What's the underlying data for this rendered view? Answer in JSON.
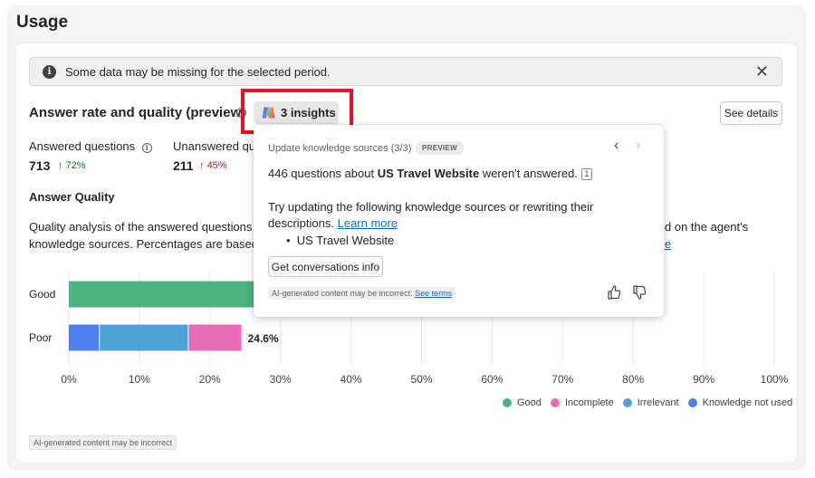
{
  "page": {
    "title": "Usage",
    "warning": {
      "text": "Some data may be missing for the selected period.",
      "close_glyph": "✕"
    },
    "section": {
      "title": "Answer rate and quality (preview)",
      "insights_label": "3 insights",
      "see_details_label": "See details"
    },
    "metrics": {
      "answered": {
        "label": "Answered questions",
        "value": "713",
        "trend": "72%",
        "direction": "up"
      },
      "unanswered": {
        "label": "Unanswered qu",
        "value": "211",
        "trend": "45%",
        "direction": "up"
      }
    },
    "answer_quality": {
      "title": "Answer Quality",
      "desc_line1_a": "Quality analysis of the answered questions",
      "desc_line1_b": "d on the agent's",
      "desc_line2_a": "knowledge sources. Percentages are based",
      "desc_line2_b": "e"
    },
    "legend": [
      {
        "name": "Good",
        "color": "#4db380"
      },
      {
        "name": "Incomplete",
        "color": "#e86bb5"
      },
      {
        "name": "Irrelevant",
        "color": "#4fa3d9"
      },
      {
        "name": "Knowledge not used",
        "color": "#4f80f0"
      }
    ],
    "ai_note": "AI-generated content may be incorrect"
  },
  "popup": {
    "header": "Update knowledge sources (3/3)",
    "badge": "PREVIEW",
    "prev_glyph": "‹",
    "next_glyph": "›",
    "line1_a": "446 questions about ",
    "line1_bold": "US Travel Website",
    "line1_b": " weren't answered.",
    "ref_number": "1",
    "line2": "Try updating the following knowledge sources or rewriting their",
    "line3_a": "descriptions.",
    "learn_more": "Learn more",
    "bullet": "US Travel Website",
    "get_conversations": "Get conversations info",
    "note_text": "AI-generated content may be incorrect.",
    "see_terms": "See terms"
  },
  "chart_data": {
    "type": "bar",
    "orientation": "horizontal",
    "stacked": true,
    "categories": [
      "Good",
      "Poor"
    ],
    "series": [
      {
        "name": "Good",
        "color": "#4db380",
        "values": [
          75.4,
          0
        ]
      },
      {
        "name": "Knowledge not used",
        "color": "#4f80f0",
        "values": [
          0,
          4.4
        ]
      },
      {
        "name": "Irrelevant",
        "color": "#4fa3d9",
        "values": [
          0,
          12.6
        ]
      },
      {
        "name": "Incomplete",
        "color": "#e86bb5",
        "values": [
          0,
          7.6
        ]
      }
    ],
    "data_labels": [
      "",
      "24.6%"
    ],
    "xlim": [
      0,
      100
    ],
    "xticks": [
      "0%",
      "10%",
      "20%",
      "30%",
      "40%",
      "50%",
      "60%",
      "70%",
      "80%",
      "90%",
      "100%"
    ],
    "grid": true
  }
}
